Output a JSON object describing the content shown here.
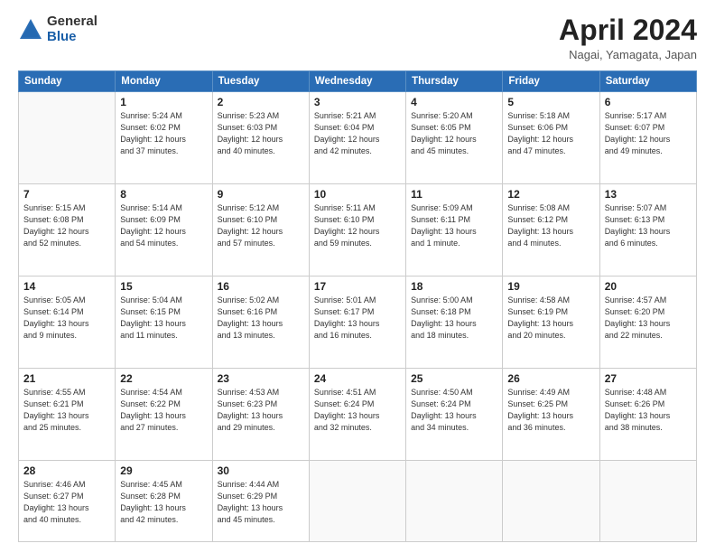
{
  "header": {
    "logo_general": "General",
    "logo_blue": "Blue",
    "month_title": "April 2024",
    "location": "Nagai, Yamagata, Japan"
  },
  "days_of_week": [
    "Sunday",
    "Monday",
    "Tuesday",
    "Wednesday",
    "Thursday",
    "Friday",
    "Saturday"
  ],
  "weeks": [
    [
      {
        "day": "",
        "info": ""
      },
      {
        "day": "1",
        "info": "Sunrise: 5:24 AM\nSunset: 6:02 PM\nDaylight: 12 hours\nand 37 minutes."
      },
      {
        "day": "2",
        "info": "Sunrise: 5:23 AM\nSunset: 6:03 PM\nDaylight: 12 hours\nand 40 minutes."
      },
      {
        "day": "3",
        "info": "Sunrise: 5:21 AM\nSunset: 6:04 PM\nDaylight: 12 hours\nand 42 minutes."
      },
      {
        "day": "4",
        "info": "Sunrise: 5:20 AM\nSunset: 6:05 PM\nDaylight: 12 hours\nand 45 minutes."
      },
      {
        "day": "5",
        "info": "Sunrise: 5:18 AM\nSunset: 6:06 PM\nDaylight: 12 hours\nand 47 minutes."
      },
      {
        "day": "6",
        "info": "Sunrise: 5:17 AM\nSunset: 6:07 PM\nDaylight: 12 hours\nand 49 minutes."
      }
    ],
    [
      {
        "day": "7",
        "info": "Sunrise: 5:15 AM\nSunset: 6:08 PM\nDaylight: 12 hours\nand 52 minutes."
      },
      {
        "day": "8",
        "info": "Sunrise: 5:14 AM\nSunset: 6:09 PM\nDaylight: 12 hours\nand 54 minutes."
      },
      {
        "day": "9",
        "info": "Sunrise: 5:12 AM\nSunset: 6:10 PM\nDaylight: 12 hours\nand 57 minutes."
      },
      {
        "day": "10",
        "info": "Sunrise: 5:11 AM\nSunset: 6:10 PM\nDaylight: 12 hours\nand 59 minutes."
      },
      {
        "day": "11",
        "info": "Sunrise: 5:09 AM\nSunset: 6:11 PM\nDaylight: 13 hours\nand 1 minute."
      },
      {
        "day": "12",
        "info": "Sunrise: 5:08 AM\nSunset: 6:12 PM\nDaylight: 13 hours\nand 4 minutes."
      },
      {
        "day": "13",
        "info": "Sunrise: 5:07 AM\nSunset: 6:13 PM\nDaylight: 13 hours\nand 6 minutes."
      }
    ],
    [
      {
        "day": "14",
        "info": "Sunrise: 5:05 AM\nSunset: 6:14 PM\nDaylight: 13 hours\nand 9 minutes."
      },
      {
        "day": "15",
        "info": "Sunrise: 5:04 AM\nSunset: 6:15 PM\nDaylight: 13 hours\nand 11 minutes."
      },
      {
        "day": "16",
        "info": "Sunrise: 5:02 AM\nSunset: 6:16 PM\nDaylight: 13 hours\nand 13 minutes."
      },
      {
        "day": "17",
        "info": "Sunrise: 5:01 AM\nSunset: 6:17 PM\nDaylight: 13 hours\nand 16 minutes."
      },
      {
        "day": "18",
        "info": "Sunrise: 5:00 AM\nSunset: 6:18 PM\nDaylight: 13 hours\nand 18 minutes."
      },
      {
        "day": "19",
        "info": "Sunrise: 4:58 AM\nSunset: 6:19 PM\nDaylight: 13 hours\nand 20 minutes."
      },
      {
        "day": "20",
        "info": "Sunrise: 4:57 AM\nSunset: 6:20 PM\nDaylight: 13 hours\nand 22 minutes."
      }
    ],
    [
      {
        "day": "21",
        "info": "Sunrise: 4:55 AM\nSunset: 6:21 PM\nDaylight: 13 hours\nand 25 minutes."
      },
      {
        "day": "22",
        "info": "Sunrise: 4:54 AM\nSunset: 6:22 PM\nDaylight: 13 hours\nand 27 minutes."
      },
      {
        "day": "23",
        "info": "Sunrise: 4:53 AM\nSunset: 6:23 PM\nDaylight: 13 hours\nand 29 minutes."
      },
      {
        "day": "24",
        "info": "Sunrise: 4:51 AM\nSunset: 6:24 PM\nDaylight: 13 hours\nand 32 minutes."
      },
      {
        "day": "25",
        "info": "Sunrise: 4:50 AM\nSunset: 6:24 PM\nDaylight: 13 hours\nand 34 minutes."
      },
      {
        "day": "26",
        "info": "Sunrise: 4:49 AM\nSunset: 6:25 PM\nDaylight: 13 hours\nand 36 minutes."
      },
      {
        "day": "27",
        "info": "Sunrise: 4:48 AM\nSunset: 6:26 PM\nDaylight: 13 hours\nand 38 minutes."
      }
    ],
    [
      {
        "day": "28",
        "info": "Sunrise: 4:46 AM\nSunset: 6:27 PM\nDaylight: 13 hours\nand 40 minutes."
      },
      {
        "day": "29",
        "info": "Sunrise: 4:45 AM\nSunset: 6:28 PM\nDaylight: 13 hours\nand 42 minutes."
      },
      {
        "day": "30",
        "info": "Sunrise: 4:44 AM\nSunset: 6:29 PM\nDaylight: 13 hours\nand 45 minutes."
      },
      {
        "day": "",
        "info": ""
      },
      {
        "day": "",
        "info": ""
      },
      {
        "day": "",
        "info": ""
      },
      {
        "day": "",
        "info": ""
      }
    ]
  ]
}
